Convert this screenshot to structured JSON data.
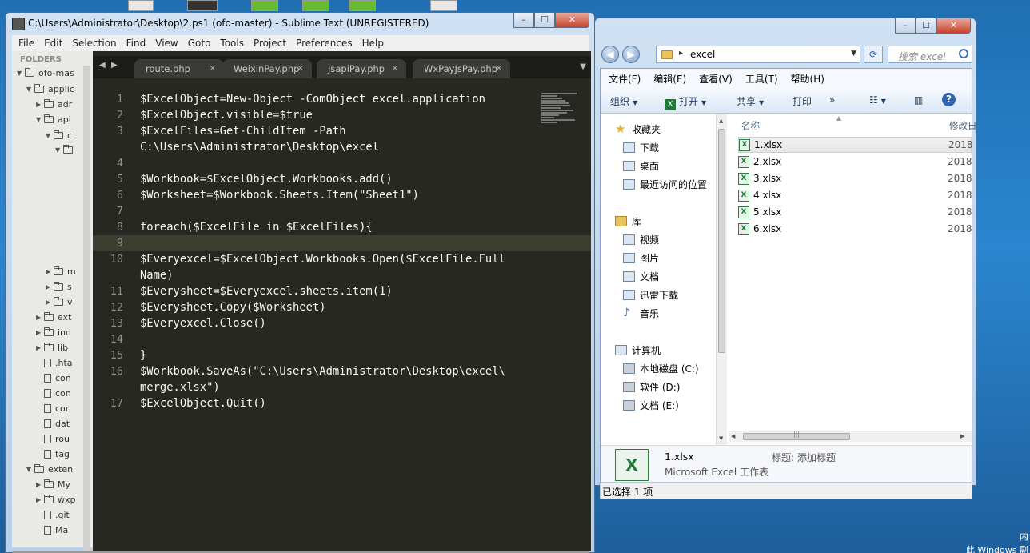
{
  "sublime": {
    "title": "C:\\Users\\Administrator\\Desktop\\2.ps1 (ofo-master) - Sublime Text (UNREGISTERED)",
    "menu": [
      "File",
      "Edit",
      "Selection",
      "Find",
      "View",
      "Goto",
      "Tools",
      "Project",
      "Preferences",
      "Help"
    ],
    "sidebar_header": "FOLDERS",
    "tree": [
      {
        "label": "ofo-mas",
        "kind": "folder",
        "depth": 0,
        "open": true
      },
      {
        "label": "applic",
        "kind": "folder",
        "depth": 1,
        "open": true
      },
      {
        "label": "adr",
        "kind": "folder",
        "depth": 2,
        "open": false
      },
      {
        "label": "api",
        "kind": "folder",
        "depth": 2,
        "open": true
      },
      {
        "label": "c",
        "kind": "folder",
        "depth": 3,
        "open": true
      },
      {
        "label": "",
        "kind": "folder",
        "depth": 4,
        "open": true
      },
      {
        "label": "m",
        "kind": "folder",
        "depth": 3,
        "open": false
      },
      {
        "label": "s",
        "kind": "folder",
        "depth": 3,
        "open": false
      },
      {
        "label": "v",
        "kind": "folder",
        "depth": 3,
        "open": false
      },
      {
        "label": "ext",
        "kind": "folder",
        "depth": 2,
        "open": false
      },
      {
        "label": "ind",
        "kind": "folder",
        "depth": 2,
        "open": false
      },
      {
        "label": "lib",
        "kind": "folder",
        "depth": 2,
        "open": false
      },
      {
        "label": ".hta",
        "kind": "file",
        "depth": 2
      },
      {
        "label": "con",
        "kind": "file",
        "depth": 2
      },
      {
        "label": "con",
        "kind": "file",
        "depth": 2
      },
      {
        "label": "cor",
        "kind": "file",
        "depth": 2
      },
      {
        "label": "dat",
        "kind": "file",
        "depth": 2
      },
      {
        "label": "rou",
        "kind": "file",
        "depth": 2
      },
      {
        "label": "tag",
        "kind": "file",
        "depth": 2
      },
      {
        "label": "exten",
        "kind": "folder",
        "depth": 1,
        "open": true
      },
      {
        "label": "My",
        "kind": "folder",
        "depth": 2,
        "open": false
      },
      {
        "label": "wxp",
        "kind": "folder",
        "depth": 2,
        "open": false
      },
      {
        "label": ".git",
        "kind": "file",
        "depth": 2
      },
      {
        "label": "Ma",
        "kind": "file",
        "depth": 2
      }
    ],
    "tabs": [
      "route.php",
      "WeixinPay.php",
      "JsapiPay.php",
      "WxPayJsPay.php"
    ],
    "tab_close": "×",
    "lines": [
      {
        "n": "1",
        "text": "$ExcelObject=New-Object -ComObject excel.application"
      },
      {
        "n": "2",
        "text": "$ExcelObject.visible=$true"
      },
      {
        "n": "3",
        "text": "$ExcelFiles=Get-ChildItem -Path"
      },
      {
        "n": "",
        "text": "C:\\Users\\Administrator\\Desktop\\excel"
      },
      {
        "n": "4",
        "text": ""
      },
      {
        "n": "5",
        "text": "$Workbook=$ExcelObject.Workbooks.add()"
      },
      {
        "n": "6",
        "text": "$Worksheet=$Workbook.Sheets.Item(\"Sheet1\")"
      },
      {
        "n": "7",
        "text": ""
      },
      {
        "n": "8",
        "text": "foreach($ExcelFile in $ExcelFiles){"
      },
      {
        "n": "9",
        "text": ""
      },
      {
        "n": "10",
        "text": "$Everyexcel=$ExcelObject.Workbooks.Open($ExcelFile.Full"
      },
      {
        "n": "",
        "text": "Name)"
      },
      {
        "n": "11",
        "text": "$Everysheet=$Everyexcel.sheets.item(1)"
      },
      {
        "n": "12",
        "text": "$Everysheet.Copy($Worksheet)"
      },
      {
        "n": "13",
        "text": "$Everyexcel.Close()"
      },
      {
        "n": "14",
        "text": ""
      },
      {
        "n": "15",
        "text": "}"
      },
      {
        "n": "16",
        "text": "$Workbook.SaveAs(\"C:\\Users\\Administrator\\Desktop\\excel\\"
      },
      {
        "n": "",
        "text": "merge.xlsx\")"
      },
      {
        "n": "17",
        "text": "$ExcelObject.Quit()"
      }
    ]
  },
  "explorer": {
    "address": "excel",
    "search_placeholder": "搜索 excel",
    "menu": [
      "文件(F)",
      "编辑(E)",
      "查看(V)",
      "工具(T)",
      "帮助(H)"
    ],
    "toolbar": {
      "organize": "组织",
      "open": "打开",
      "share": "共享",
      "print": "打印",
      "more": "»"
    },
    "nav": {
      "favorites": "收藏夹",
      "favorites_items": [
        "下载",
        "桌面",
        "最近访问的位置"
      ],
      "library": "库",
      "library_items": [
        "视频",
        "图片",
        "文档",
        "迅雷下载",
        "音乐"
      ],
      "computer": "计算机",
      "computer_items": [
        "本地磁盘 (C:)",
        "软件 (D:)",
        "文档 (E:)"
      ]
    },
    "columns": {
      "name": "名称",
      "modified": "修改日"
    },
    "files": [
      {
        "name": "1.xlsx",
        "date": "2018"
      },
      {
        "name": "2.xlsx",
        "date": "2018"
      },
      {
        "name": "3.xlsx",
        "date": "2018"
      },
      {
        "name": "4.xlsx",
        "date": "2018"
      },
      {
        "name": "5.xlsx",
        "date": "2018"
      },
      {
        "name": "6.xlsx",
        "date": "2018"
      }
    ],
    "details": {
      "name": "1.xlsx",
      "type": "Microsoft Excel 工作表",
      "tag_label": "标题:",
      "tag_value": "添加标题"
    },
    "status": "已选择 1 项"
  },
  "taskbar": {
    "tray_1": "内",
    "tray_2": "此 Windows 副"
  }
}
